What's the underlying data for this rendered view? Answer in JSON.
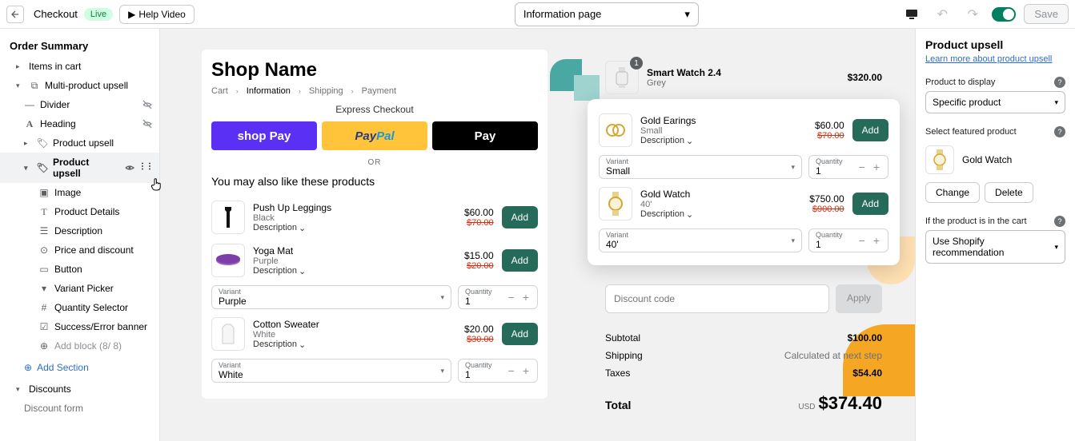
{
  "topbar": {
    "title": "Checkout",
    "badge": "Live",
    "help": "Help Video",
    "page_select": "Information page",
    "save": "Save"
  },
  "sidebar": {
    "heading": "Order Summary",
    "items_in_cart": "Items in cart",
    "multi_upsell": "Multi-product upsell",
    "divider": "Divider",
    "heading_block": "Heading",
    "product_upsell_1": "Product upsell",
    "product_upsell_2": "Product upsell",
    "image": "Image",
    "product_details": "Product Details",
    "description": "Description",
    "price_discount": "Price and discount",
    "button": "Button",
    "variant_picker": "Variant Picker",
    "qty_selector": "Quantity Selector",
    "success_error": "Success/Error banner",
    "add_block": "Add block (8/ 8)",
    "add_section": "Add Section",
    "discounts": "Discounts",
    "discount_form": "Discount form"
  },
  "preview": {
    "shop_name": "Shop Name",
    "crumbs": {
      "cart": "Cart",
      "info": "Information",
      "shipping": "Shipping",
      "payment": "Payment"
    },
    "express": "Express Checkout",
    "pay": {
      "shop": "shop Pay",
      "paypal": "PayPal",
      "apple": "Pay"
    },
    "or": "OR",
    "you_may": "You may also like these products",
    "add_label": "Add",
    "desc_label": "Description",
    "variant_label": "Variant",
    "qty_label": "Quantity",
    "products": [
      {
        "name": "Push Up Leggings",
        "variant": "Black",
        "price": "$60.00",
        "oldprice": "$70.00"
      },
      {
        "name": "Yoga Mat",
        "variant": "Purple",
        "price": "$15.00",
        "oldprice": "$20.00"
      },
      {
        "name": "Cotton Sweater",
        "variant": "White",
        "price": "$20.00",
        "oldprice": "$30.00"
      }
    ],
    "vq": [
      {
        "variant": "Purple",
        "qty": "1"
      },
      {
        "variant": "White",
        "qty": "1"
      }
    ]
  },
  "cart": {
    "smartwatch": {
      "name": "Smart Watch 2.4",
      "variant": "Grey",
      "price": "$320.00",
      "badge": "1"
    },
    "upsell": [
      {
        "name": "Gold Earings",
        "variant": "Small",
        "price": "$60.00",
        "oldprice": "$70.00",
        "vb": "Small",
        "qty": "1"
      },
      {
        "name": "Gold Watch",
        "variant": "40'",
        "price": "$750.00",
        "oldprice": "$900.00",
        "vb": "40'",
        "qty": "1"
      }
    ],
    "discount_ph": "Discount code",
    "apply": "Apply",
    "subtotal_label": "Subtotal",
    "subtotal": "$100.00",
    "shipping_label": "Shipping",
    "shipping": "Calculated at next step",
    "taxes_label": "Taxes",
    "taxes": "$54.40",
    "total_label": "Total",
    "currency": "USD",
    "total": "$374.40"
  },
  "right": {
    "heading": "Product upsell",
    "link": "Learn more about product upsell",
    "prod_display_label": "Product to display",
    "prod_display": "Specific product",
    "featured_label": "Select featured product",
    "featured_name": "Gold Watch",
    "change": "Change",
    "delete": "Delete",
    "if_in_cart_label": "If the product is in the cart",
    "if_in_cart": "Use Shopify recommendation"
  }
}
